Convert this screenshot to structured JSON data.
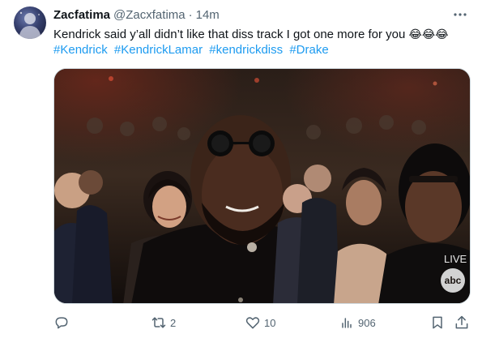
{
  "author": {
    "display_name": "Zacfatima",
    "handle": "@Zacxfatima",
    "separator": "·",
    "time": "14m"
  },
  "tweet": {
    "text": "Kendrick said y’all didn’t like that diss track I got one more for you",
    "emojis": "😂😂😂",
    "hashtags": [
      "#Kendrick",
      "#KendrickLamar",
      "#kendrickdiss",
      "#Drake"
    ]
  },
  "media": {
    "broadcast_overlay": "LIVE",
    "network_logo_text": "abc"
  },
  "actions": {
    "reply_icon": "reply-icon",
    "retweet_icon": "retweet-icon",
    "retweet_count": "2",
    "like_icon": "heart-icon",
    "like_count": "10",
    "views_icon": "views-icon",
    "views_count": "906",
    "bookmark_icon": "bookmark-icon",
    "share_icon": "share-icon"
  },
  "colors": {
    "link_blue": "#1d9bf0",
    "secondary_text": "#536471",
    "primary_text": "#0f1419"
  }
}
